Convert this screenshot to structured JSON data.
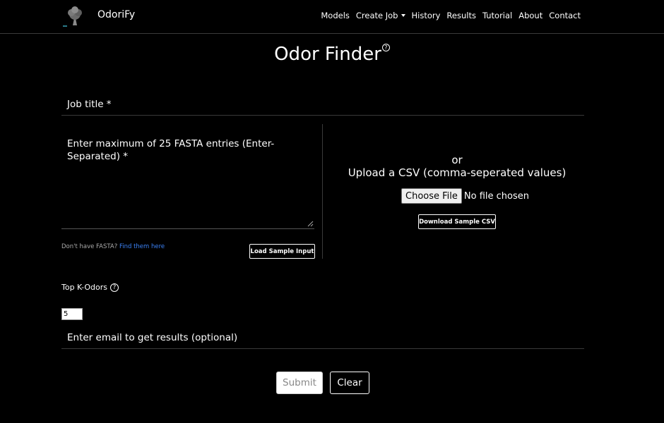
{
  "brand": {
    "name": "OdoriFy",
    "logo_icon": "tree-logo-icon"
  },
  "nav": {
    "items": [
      {
        "label": "Models"
      },
      {
        "label": "Create Job"
      },
      {
        "label": "History"
      },
      {
        "label": "Results"
      },
      {
        "label": "Tutorial"
      },
      {
        "label": "About"
      },
      {
        "label": "Contact"
      }
    ]
  },
  "page": {
    "title": "Odor Finder",
    "help_glyph": "?"
  },
  "form": {
    "job_title_label": "Job title *",
    "fasta_label": "Enter maximum of 25 FASTA entries (Enter-Separated) *",
    "fasta_help_text": "Don't have FASTA?",
    "fasta_help_link": "Find them here",
    "load_sample_label": "Load Sample Input",
    "or_text": "or",
    "upload_label": "Upload a CSV (comma-seperated values)",
    "choose_file_label": "Choose File",
    "no_file_text": "No file chosen",
    "download_sample_label": "Download Sample CSV",
    "topk_label": "Top K-Odors",
    "topk_help_glyph": "?",
    "topk_value": "5",
    "email_label": "Enter email to get results (optional)",
    "submit_label": "Submit",
    "clear_label": "Clear"
  },
  "colors": {
    "background": "#000000",
    "link": "#3b82f6",
    "divider": "#3a3a3a"
  }
}
